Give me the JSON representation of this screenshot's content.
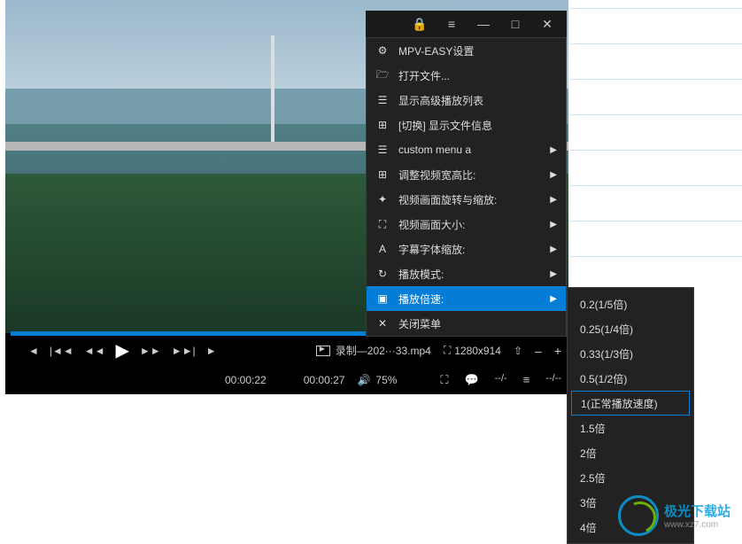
{
  "titlebar": {
    "lock_icon": "🔒",
    "menu_icon": "≡",
    "minimize": "—",
    "maximize": "□",
    "close": "✕"
  },
  "menu": {
    "items": [
      {
        "icon": "⚙",
        "label": "MPV-EASY设置",
        "arrow": false
      },
      {
        "icon": "🗁",
        "label": "打开文件...",
        "arrow": false
      },
      {
        "icon": "☰",
        "label": "显示高级播放列表",
        "arrow": false
      },
      {
        "icon": "⊞",
        "label": "[切换] 显示文件信息",
        "arrow": false
      },
      {
        "icon": "☰",
        "label": "custom menu a",
        "arrow": true
      },
      {
        "icon": "⊞",
        "label": "调整视频宽高比:",
        "arrow": true
      },
      {
        "icon": "✦",
        "label": "视频画面旋转与缩放:",
        "arrow": true
      },
      {
        "icon": "⛶",
        "label": "视频画面大小:",
        "arrow": true
      },
      {
        "icon": "A",
        "label": "字幕字体缩放:",
        "arrow": true
      },
      {
        "icon": "↻",
        "label": "播放模式:",
        "arrow": true
      },
      {
        "icon": "▣",
        "label": "播放倍速:",
        "arrow": true,
        "highlighted": true
      },
      {
        "icon": "✕",
        "label": "关闭菜单",
        "arrow": false
      }
    ]
  },
  "submenu": {
    "items": [
      {
        "label": "0.2(1/5倍)"
      },
      {
        "label": "0.25(1/4倍)"
      },
      {
        "label": "0.33(1/3倍)"
      },
      {
        "label": "0.5(1/2倍)"
      },
      {
        "label": "1(正常播放速度)",
        "selected": true
      },
      {
        "label": "1.5倍"
      },
      {
        "label": "2倍"
      },
      {
        "label": "2.5倍"
      },
      {
        "label": "3倍"
      },
      {
        "label": "4倍"
      }
    ]
  },
  "controls": {
    "filename": "录制—202···33.mp4",
    "resolution": "1280x914",
    "current_time": "00:00:22",
    "total_time": "00:00:27",
    "volume_pct": "75%",
    "subtitle_info": "--/--",
    "chat_info": "--/-",
    "dash": "–",
    "plus": "+"
  },
  "watermark": {
    "cn": "极光下载站",
    "url": "www.xz7.com"
  }
}
